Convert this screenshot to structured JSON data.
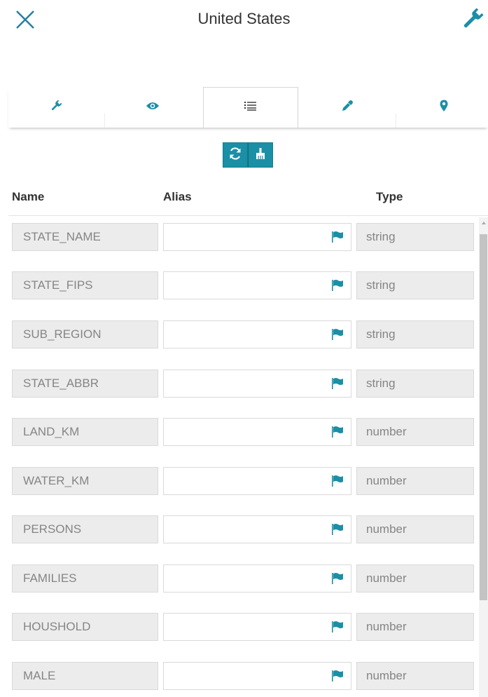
{
  "header": {
    "title": "United States",
    "close_icon": "close-icon",
    "settings_icon": "wrench-icon"
  },
  "tabs": [
    {
      "icon": "wrench-icon",
      "active": false
    },
    {
      "icon": "eye-icon",
      "active": false
    },
    {
      "icon": "list-icon",
      "active": true
    },
    {
      "icon": "eyedropper-icon",
      "active": false
    },
    {
      "icon": "map-marker-icon",
      "active": false
    }
  ],
  "actions": [
    {
      "icon": "refresh-icon"
    },
    {
      "icon": "broom-icon"
    }
  ],
  "columns": {
    "name": "Name",
    "alias": "Alias",
    "type": "Type"
  },
  "fields": [
    {
      "name": "STATE_NAME",
      "alias": "",
      "type": "string"
    },
    {
      "name": "STATE_FIPS",
      "alias": "",
      "type": "string"
    },
    {
      "name": "SUB_REGION",
      "alias": "",
      "type": "string"
    },
    {
      "name": "STATE_ABBR",
      "alias": "",
      "type": "string"
    },
    {
      "name": "LAND_KM",
      "alias": "",
      "type": "number"
    },
    {
      "name": "WATER_KM",
      "alias": "",
      "type": "number"
    },
    {
      "name": "PERSONS",
      "alias": "",
      "type": "number"
    },
    {
      "name": "FAMILIES",
      "alias": "",
      "type": "number"
    },
    {
      "name": "HOUSHOLD",
      "alias": "",
      "type": "number"
    },
    {
      "name": "MALE",
      "alias": "",
      "type": "number"
    }
  ],
  "colors": {
    "accent": "#1a8fa6",
    "text": "#323232",
    "muted_text": "#858585",
    "field_bg": "#ececec",
    "close_icon": "#2a7fa0"
  }
}
